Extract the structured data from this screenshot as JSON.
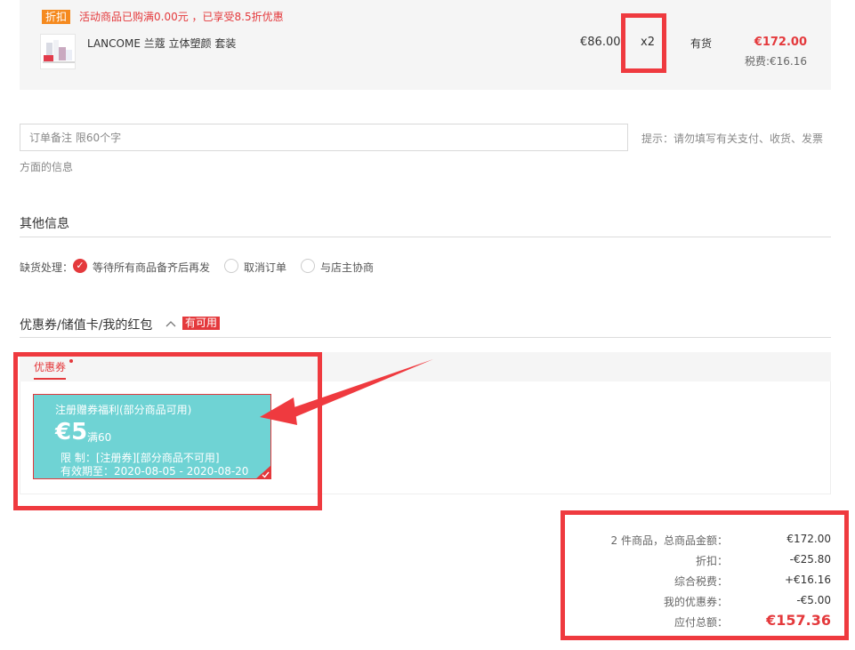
{
  "product": {
    "promo_tag": "折扣",
    "promo_text": "活动商品已购满0.00元 ，已享受8.5折优惠",
    "name": "LANCOME 兰蔻 立体塑颜 套装",
    "unit_price": "€86.00",
    "quantity": "x2",
    "stock": "有货",
    "subtotal": "€172.00",
    "tax": "税费:€16.16"
  },
  "remark": {
    "placeholder": "订单备注 限60个字",
    "hint_line1": "提示：请勿填写有关支付、收货、发票",
    "hint_line2": "方面的信息"
  },
  "other_info": {
    "title": "其他信息",
    "out_of_stock_label": "缺货处理：",
    "options": [
      {
        "label": "等待所有商品备齐后再发",
        "checked": true
      },
      {
        "label": "取消订单",
        "checked": false
      },
      {
        "label": "与店主协商",
        "checked": false
      }
    ]
  },
  "coupons": {
    "section_title": "优惠券/储值卡/我的红包",
    "available_badge": "有可用",
    "tab_label": "优惠券",
    "card": {
      "title": "注册赠券福利(部分商品可用)",
      "amount": "€5",
      "threshold": "满60",
      "restriction": "限  制：[注册券][部分商品不可用]",
      "validity": "有效期至：2020-08-05 - 2020-08-20",
      "selected": true
    }
  },
  "summary": {
    "items": [
      {
        "label": "2 件商品，总商品金额：",
        "value": "€172.00"
      },
      {
        "label": "折扣：",
        "value": "-€25.80"
      },
      {
        "label": "综合税费：",
        "value": "+€16.16"
      },
      {
        "label": "我的优惠券：",
        "value": "-€5.00"
      }
    ],
    "total_label": "应付总额：",
    "total_value": "€157.36"
  },
  "colors": {
    "accent_red": "#e4393c",
    "annotation_red": "#ef3a3f",
    "coupon_teal": "#6fd3d4",
    "promo_orange": "#f58a1f"
  }
}
